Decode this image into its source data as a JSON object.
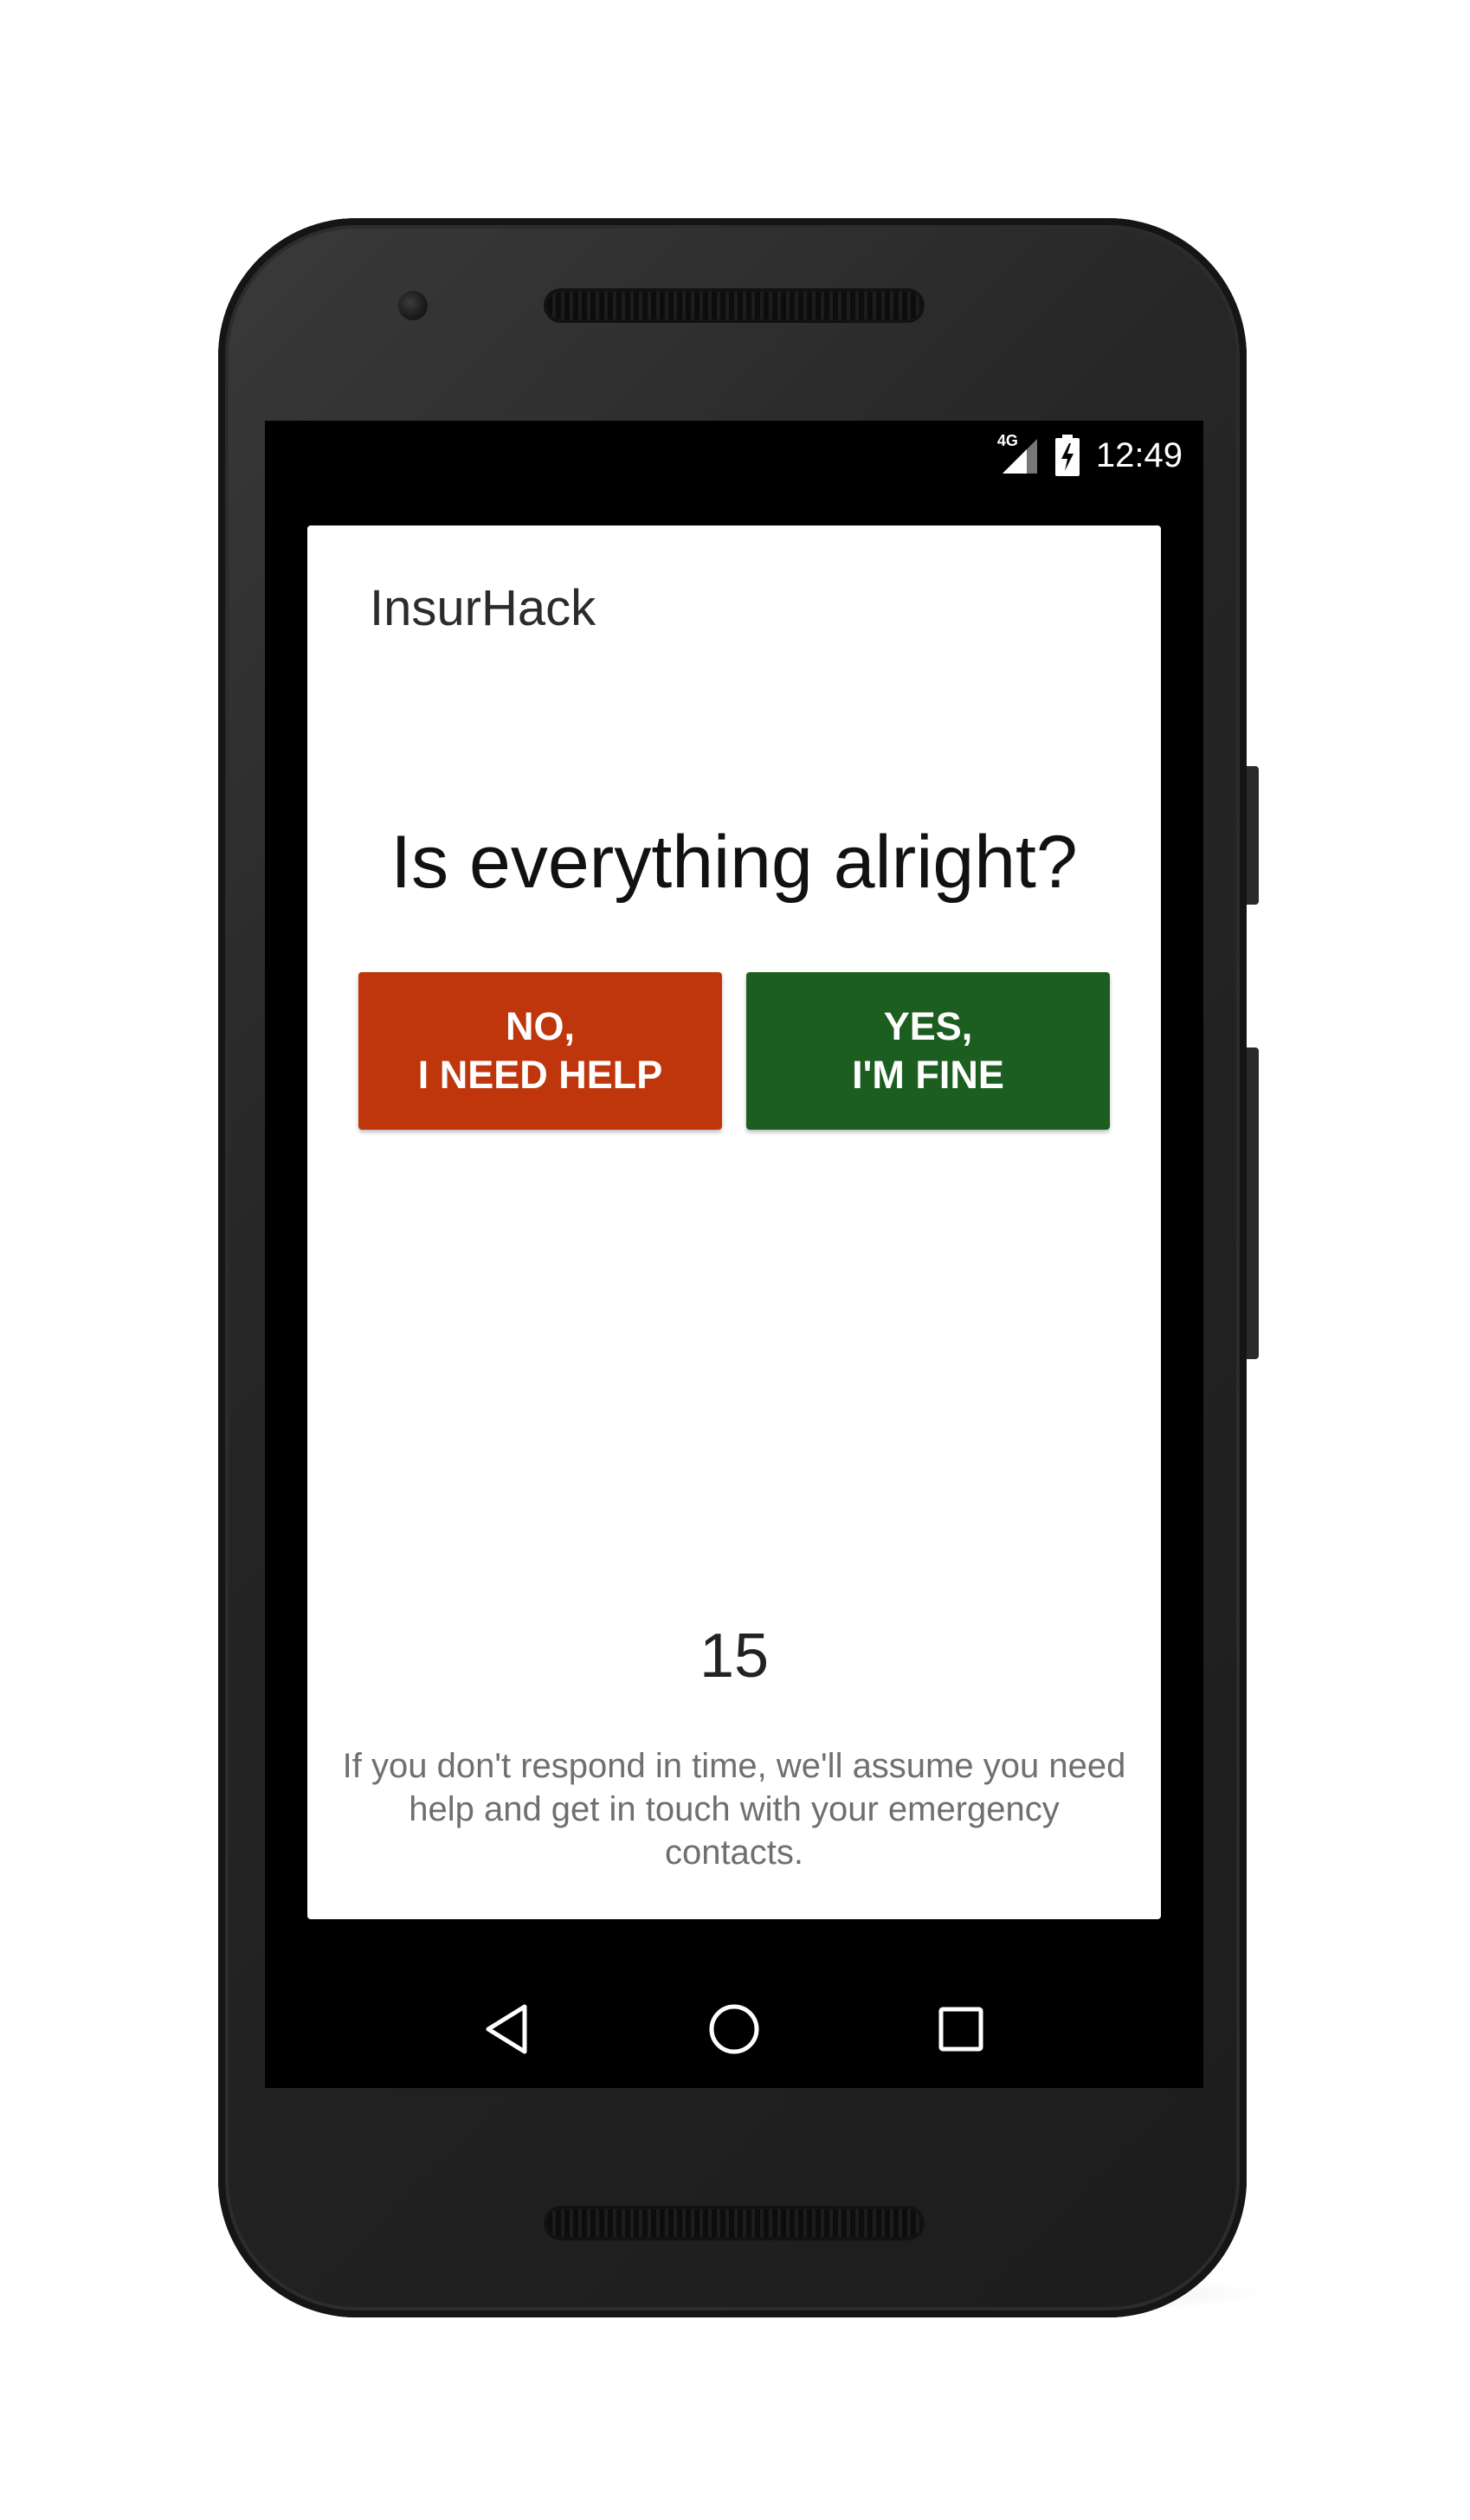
{
  "status_bar": {
    "network": "4G",
    "time": "12:49"
  },
  "dialog": {
    "app_title": "InsurHack",
    "question": "Is everything alright?",
    "no_button": {
      "line1": "NO,",
      "line2": "I NEED HELP",
      "color": "#bf360c"
    },
    "yes_button": {
      "line1": "YES,",
      "line2": "I'M FINE",
      "color": "#1b5e20"
    },
    "countdown": "15",
    "notice": "If you don't respond in time, we'll assume you need help and get in touch with your emergency contacts."
  },
  "nav_bar": {
    "icons": [
      "back-icon",
      "home-icon",
      "recents-icon"
    ]
  }
}
